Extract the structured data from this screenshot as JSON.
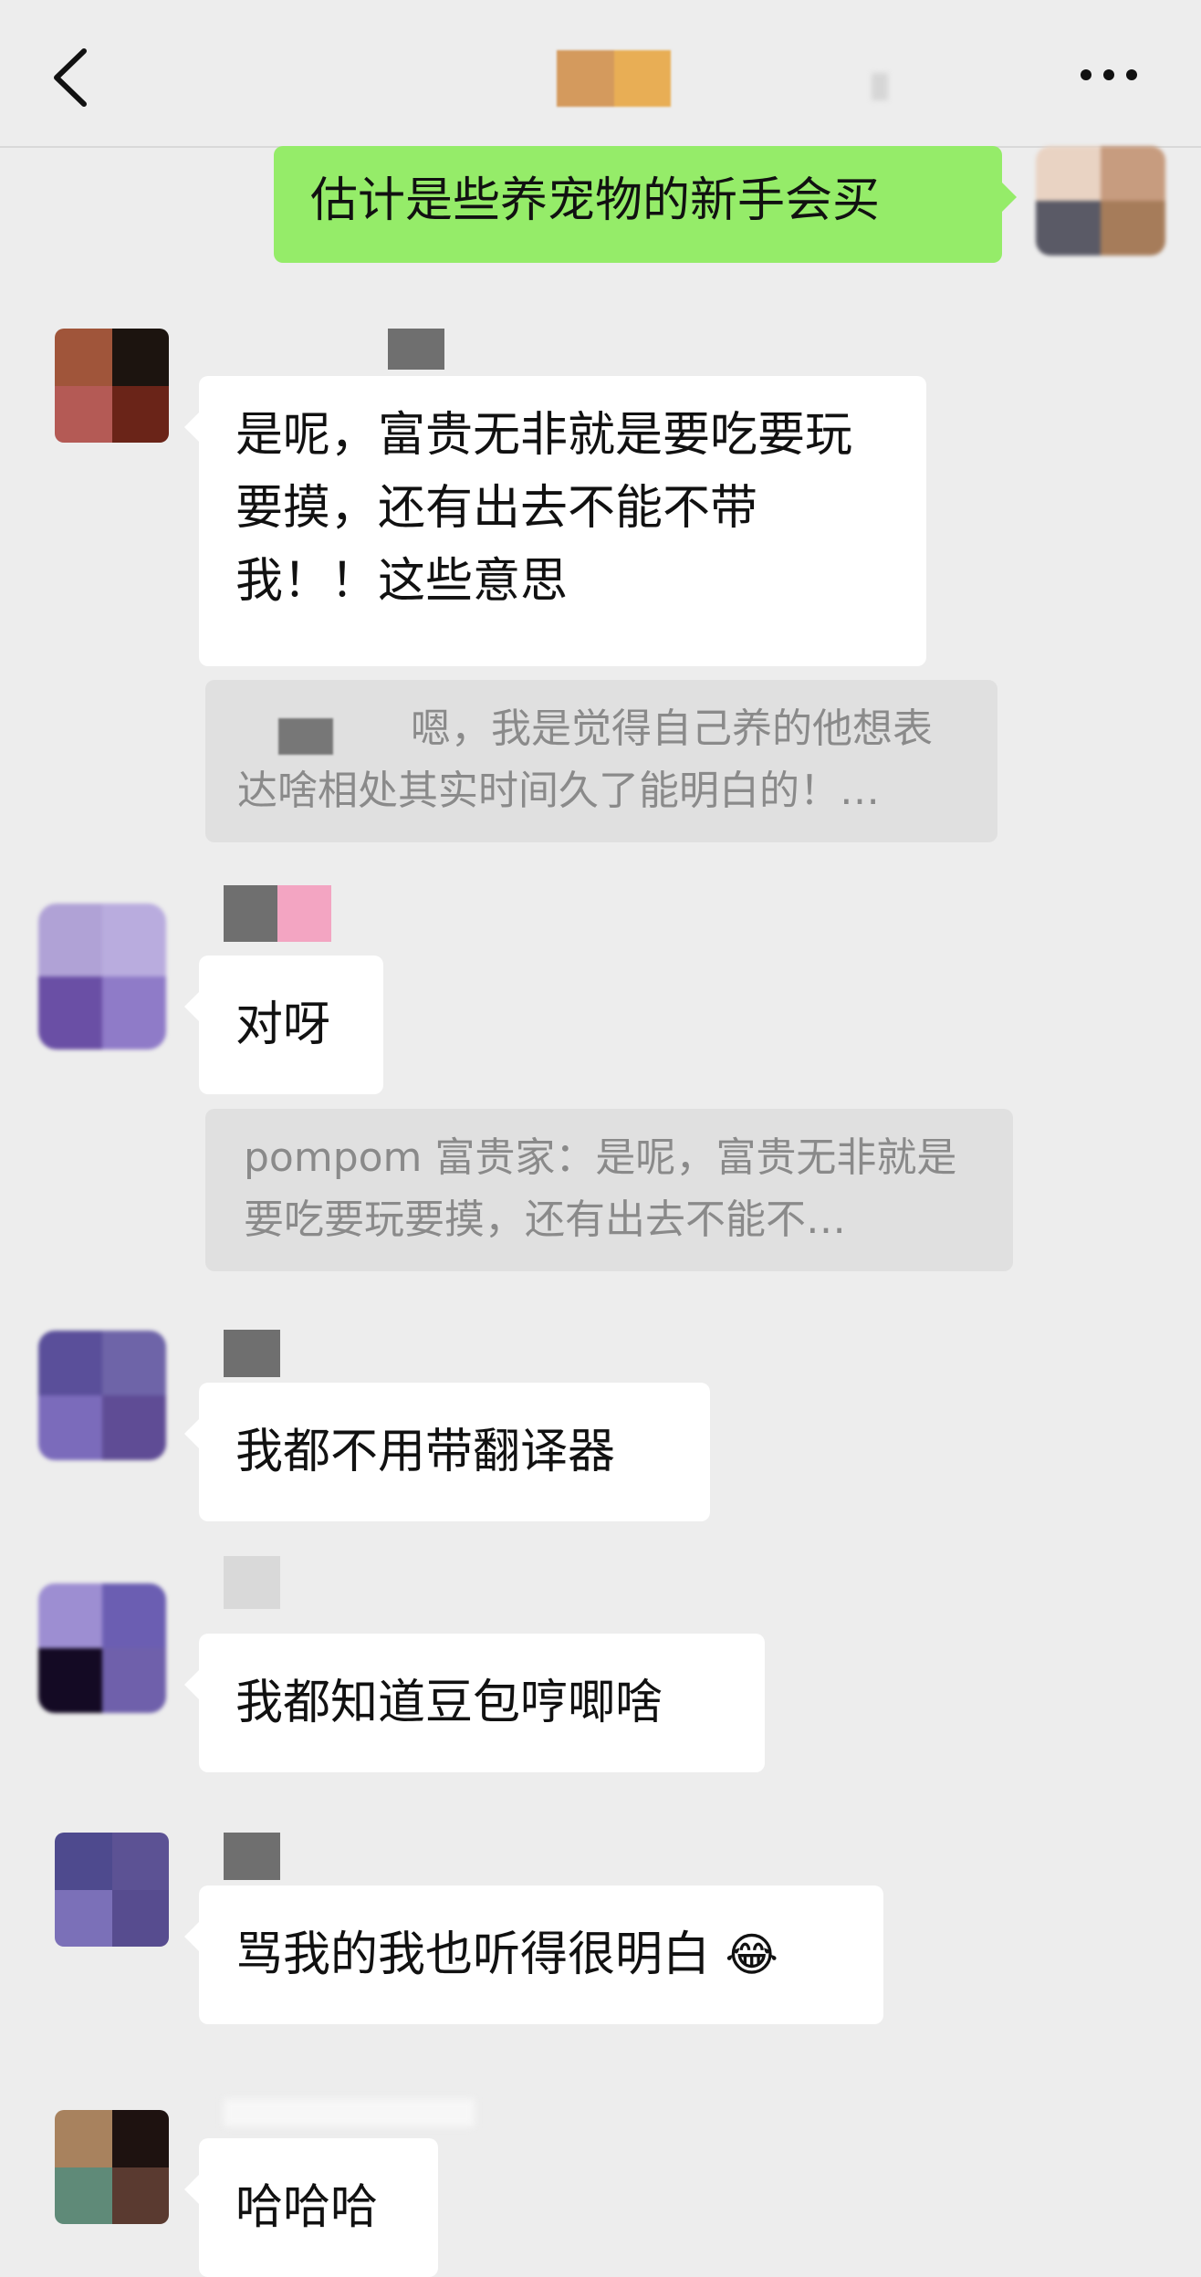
{
  "header": {
    "title": "",
    "back_icon": "chevron-left-icon",
    "more_icon": "more-horizontal-icon"
  },
  "messages": [
    {
      "sender": "me",
      "text": "估计是些养宠物的新手会买"
    },
    {
      "sender": "other",
      "text": "是呢，富贵无非就是要吃要玩要摸，还有出去不能不带我！！这些意思"
    },
    {
      "sender": "quote",
      "text": "嗯，我是觉得自己养的他想表达啥相处其实时间久了能明白的！…"
    },
    {
      "sender": "other",
      "text": "对呀"
    },
    {
      "sender": "quote",
      "text": "pompom 富贵家：是呢，富贵无非就是要吃要玩要摸，还有出去不能不…"
    },
    {
      "sender": "other",
      "text": "我都不用带翻译器"
    },
    {
      "sender": "other",
      "text": "我都知道豆包哼唧啥"
    },
    {
      "sender": "other",
      "text": "骂我的我也听得很明白",
      "emoji": "😂"
    },
    {
      "sender": "other",
      "text": "哈哈哈"
    }
  ],
  "colors": {
    "background": "#ededed",
    "my_bubble": "#95ec69",
    "other_bubble": "#ffffff",
    "quote_bubble": "#e0e0e0"
  }
}
